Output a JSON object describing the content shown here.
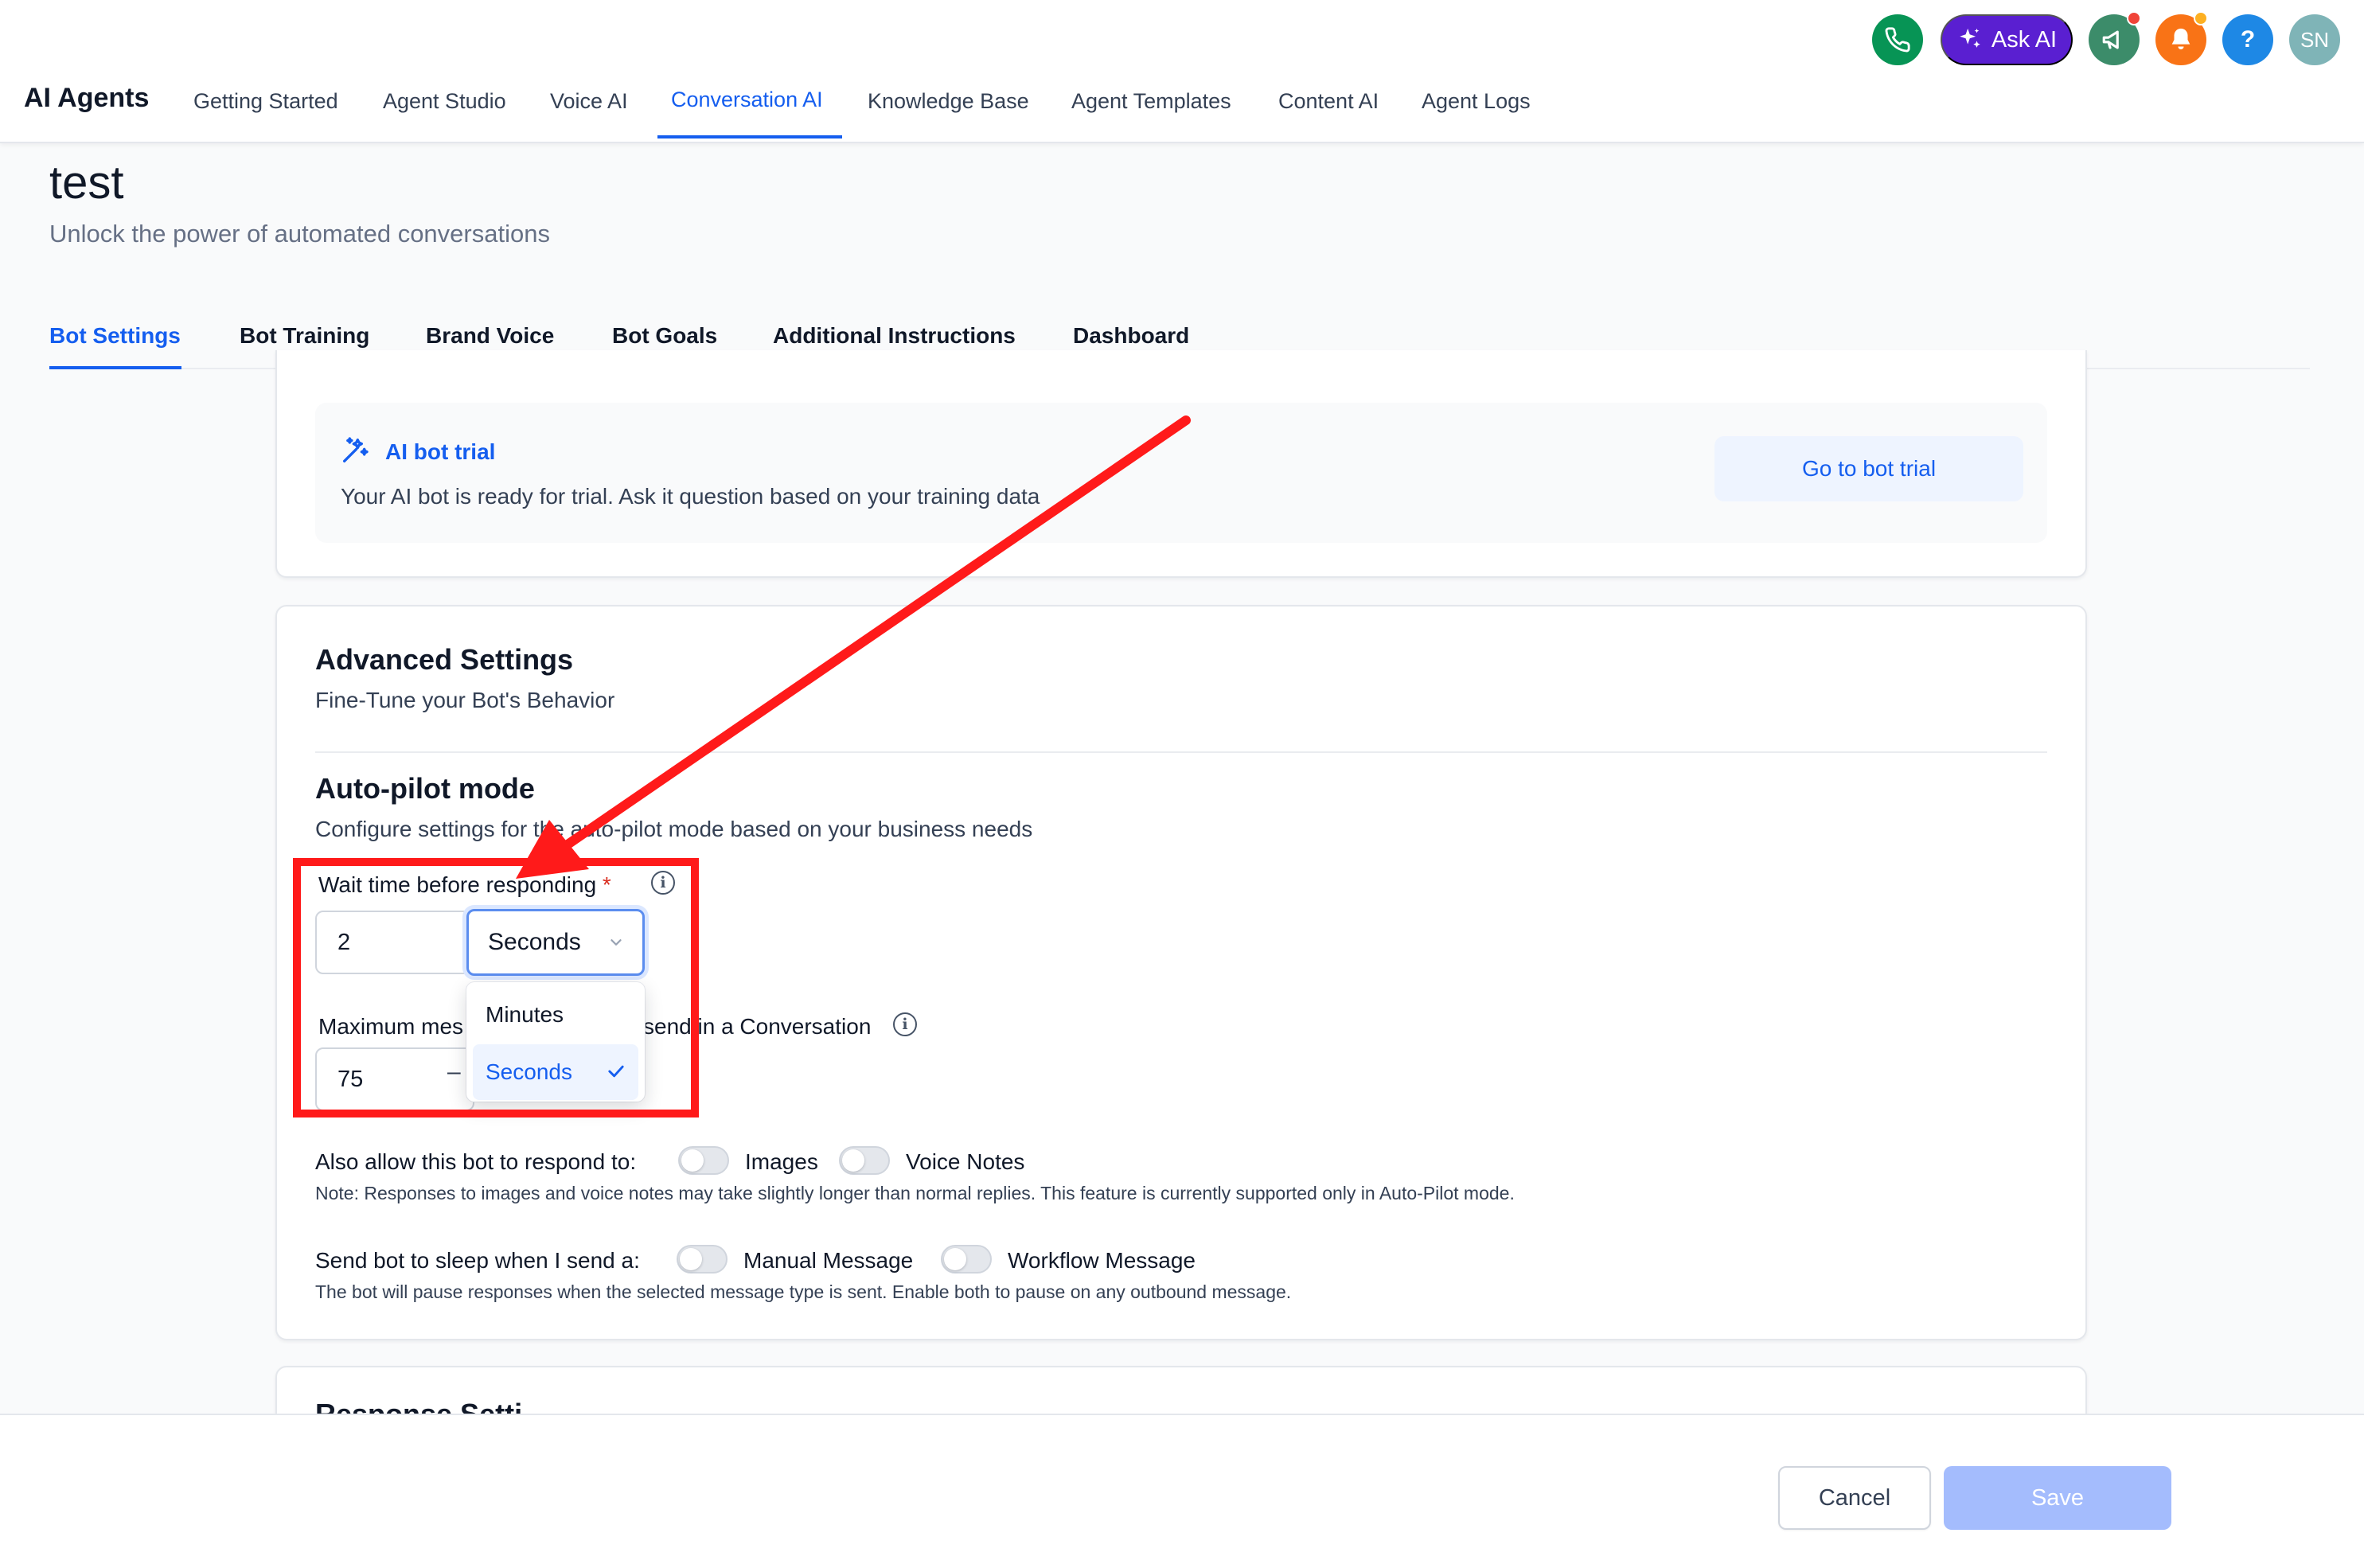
{
  "app": {
    "name": "AI Agents"
  },
  "nav": {
    "items": [
      {
        "label": "Getting Started",
        "active": false
      },
      {
        "label": "Agent Studio",
        "active": false
      },
      {
        "label": "Voice AI",
        "active": false
      },
      {
        "label": "Conversation AI",
        "active": true
      },
      {
        "label": "Knowledge Base",
        "active": false
      },
      {
        "label": "Agent Templates",
        "active": false
      },
      {
        "label": "Content AI",
        "active": false
      },
      {
        "label": "Agent Logs",
        "active": false
      }
    ]
  },
  "top_actions": {
    "ask_ai_label": "Ask AI",
    "help_label": "?",
    "avatar_initials": "SN",
    "icons": [
      "phone-icon",
      "sparkle-icon",
      "megaphone-icon",
      "bell-icon",
      "help-icon"
    ]
  },
  "page": {
    "title": "test",
    "subtitle": "Unlock the power of automated conversations"
  },
  "tabs": [
    {
      "label": "Bot Settings",
      "active": true
    },
    {
      "label": "Bot Training",
      "active": false
    },
    {
      "label": "Brand Voice",
      "active": false
    },
    {
      "label": "Bot Goals",
      "active": false
    },
    {
      "label": "Additional Instructions",
      "active": false
    },
    {
      "label": "Dashboard",
      "active": false
    }
  ],
  "trial": {
    "title": "AI bot trial",
    "description": "Your AI bot is ready for trial. Ask it question based on your training data",
    "button_label": "Go to bot trial"
  },
  "advanced": {
    "title": "Advanced Settings",
    "subtitle": "Fine-Tune your Bot's Behavior",
    "autopilot": {
      "title": "Auto-pilot mode",
      "subtitle": "Configure settings for the auto-pilot mode based on your business needs",
      "wait_time": {
        "label": "Wait time before responding",
        "required_mark": "*",
        "value": "2",
        "unit_selected": "Seconds",
        "unit_options": [
          "Minutes",
          "Seconds"
        ]
      },
      "max_messages": {
        "label_start": "Maximum mes",
        "label_end": "send in a Conversation",
        "value": "75",
        "minus": "–"
      }
    },
    "respond_to": {
      "label": "Also allow this bot to respond to:",
      "options": [
        {
          "label": "Images",
          "enabled": false
        },
        {
          "label": "Voice Notes",
          "enabled": false
        }
      ],
      "note": "Note: Responses to images and voice notes may take slightly longer than normal replies. This feature is currently supported only in Auto-Pilot mode."
    },
    "sleep": {
      "label": "Send bot to sleep when I send a:",
      "options": [
        {
          "label": "Manual Message",
          "enabled": false
        },
        {
          "label": "Workflow Message",
          "enabled": false
        }
      ],
      "note": "The bot will pause responses when the selected message type is sent. Enable both to pause on any outbound message."
    }
  },
  "next_section_peek": "Response Setti",
  "footer": {
    "cancel_label": "Cancel",
    "save_label": "Save"
  },
  "colors": {
    "primary": "#155eef",
    "annotation": "#ff1a1a",
    "save_disabled": "#a4bcfd",
    "ask_ai": "#5a1fd1"
  }
}
